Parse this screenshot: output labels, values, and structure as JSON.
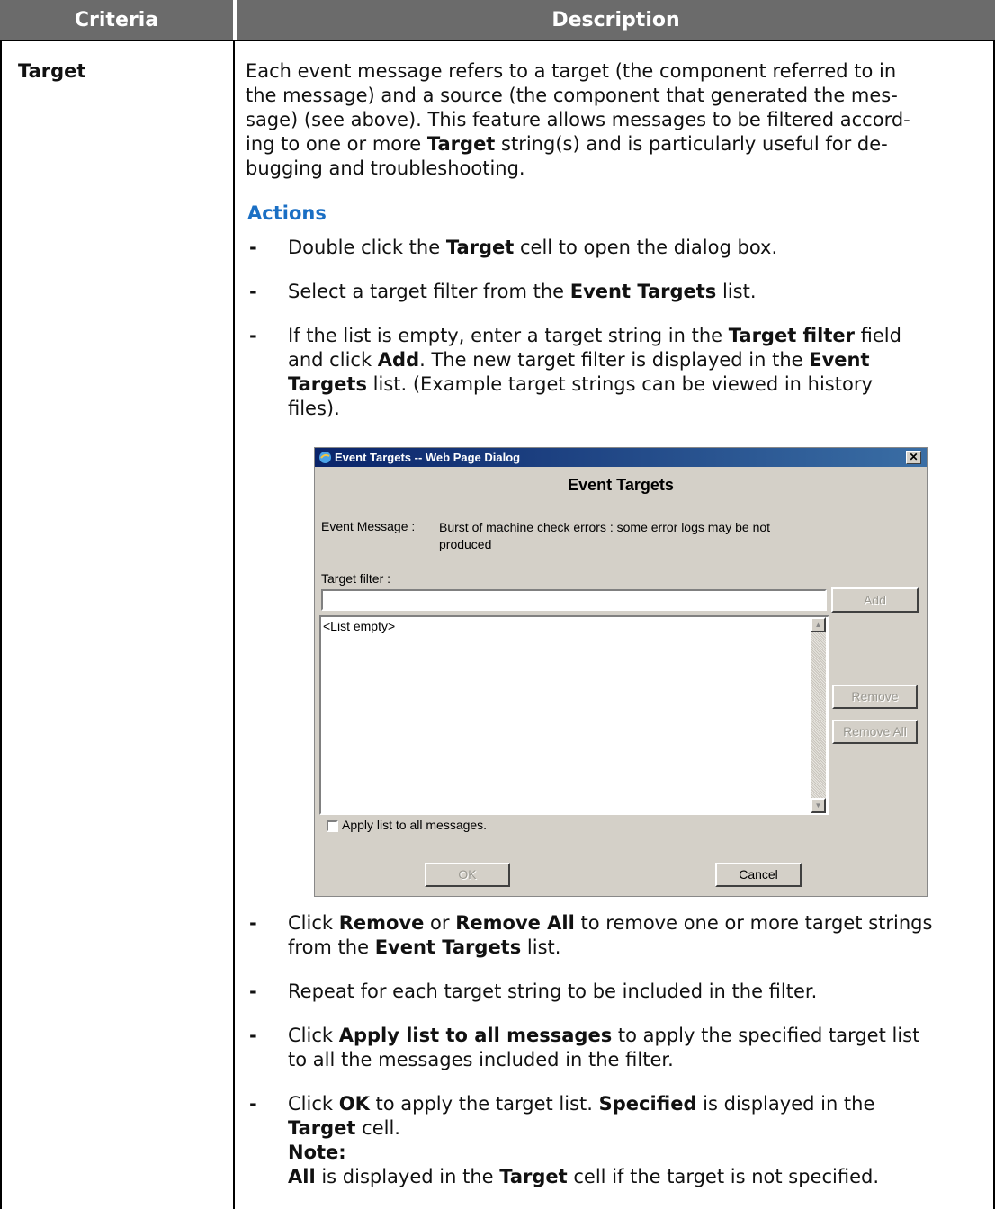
{
  "table": {
    "headers": [
      "Criteria",
      "Description"
    ],
    "criteria": "Target",
    "intro_lines": [
      "Each event message refers to a target (the component referred to in",
      "the message) and a source (the component that generated the mes-",
      "sage) (see above). This feature allows messages to be filtered accord-",
      "ing to one or more **Target** string(s) and is particularly useful for de-",
      "bugging and troubleshooting."
    ],
    "actions_heading": "Actions",
    "bullets_before": [
      {
        "lines": [
          "Double click the **Target** cell to open the dialog box."
        ]
      },
      {
        "lines": [
          "Select a target filter from the **Event Targets** list."
        ]
      },
      {
        "lines": [
          "If the list is empty, enter a target string in the **Target filter** field",
          "and click **Add**. The new target filter is displayed in the **Event**",
          "**Targets** list. (Example target strings can be viewed in history",
          "files)."
        ]
      }
    ],
    "bullets_after": [
      {
        "lines": [
          "Click **Remove** or **Remove All** to remove one or more target strings",
          "from the **Event Targets** list."
        ]
      },
      {
        "lines": [
          "Repeat for each target string to be included in the filter."
        ]
      },
      {
        "lines": [
          "Click **Apply list to all messages** to apply the specified target list",
          "to all the messages included in the filter."
        ]
      },
      {
        "lines": [
          "Click **OK** to apply the target list. **Specified** is displayed in the",
          "**Target** cell.",
          "**Note:**",
          "**All** is displayed in the **Target** cell if the target is not specified."
        ]
      }
    ]
  },
  "dialog": {
    "window_title": "Event Targets -- Web Page Dialog",
    "close_glyph": "✕",
    "heading": "Event Targets",
    "event_message_label": "Event Message :",
    "event_message_lines": [
      "Burst of machine check errors : some error logs may be not",
      "produced"
    ],
    "target_filter_label": "Target filter :",
    "target_filter_value": "",
    "add_button": "Add",
    "list_empty": "<List empty>",
    "remove_button": "Remove",
    "remove_all_button": "Remove All",
    "apply_checkbox_label": "Apply list to all messages.",
    "apply_checked": false,
    "ok_button": "OK",
    "cancel_button": "Cancel"
  },
  "colors": {
    "header_bg": "#6b6b6b",
    "actions_heading": "#1a6fc4",
    "dialog_bg": "#d4d0c8",
    "titlebar": "#0a246a"
  }
}
